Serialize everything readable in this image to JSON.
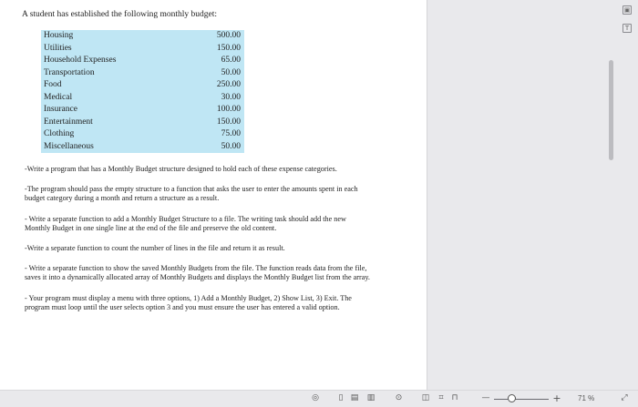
{
  "document": {
    "intro": "A student has established the following monthly budget:",
    "budget": [
      {
        "category": "Housing",
        "amount": "500.00"
      },
      {
        "category": "Utilities",
        "amount": "150.00"
      },
      {
        "category": "Household Expenses",
        "amount": "65.00"
      },
      {
        "category": "Transportation",
        "amount": "50.00"
      },
      {
        "category": "Food",
        "amount": "250.00"
      },
      {
        "category": "Medical",
        "amount": "30.00"
      },
      {
        "category": "Insurance",
        "amount": "100.00"
      },
      {
        "category": "Entertainment",
        "amount": "150.00"
      },
      {
        "category": "Clothing",
        "amount": "75.00"
      },
      {
        "category": "Miscellaneous",
        "amount": "50.00"
      }
    ],
    "paragraphs": [
      "-Write a program that has a Monthly Budget structure designed to hold each of these expense categories.",
      "-The program should pass the empty structure to a function that asks the user to enter the amounts spent in each budget category during a month and return a structure as a result.",
      "- Write a separate function to add a Monthly Budget Structure to a file. The writing task should add the new Monthly Budget in one single line at the end of the file and preserve the old content.",
      "-Write a separate function to count the number of lines in the file and return it as result.",
      "- Write a separate function to show the saved Monthly Budgets from the file. The function reads data from the file, saves it into a dynamically allocated array of Monthly Budgets and displays the Monthly Budget list from the array.",
      "- Your program must display a menu with three options, 1) Add a Monthly Budget, 2) Show List, 3) Exit. The program must loop until the user selects option 3 and you must ensure the user has entered a valid option."
    ]
  },
  "sidebar_icons": [
    "image-icon",
    "text-recognition-icon"
  ],
  "status_bar": {
    "icons": [
      "eye-icon",
      "single-page-icon",
      "double-page-icon",
      "book-view-icon",
      "play-icon",
      "dual-view-icon",
      "translate-icon",
      "bookmark-icon"
    ],
    "zoom_minus": "—",
    "zoom_plus": "+",
    "zoom_level": "71 %",
    "zoom_fraction": 0.32,
    "fit_icon": "expand-icon"
  }
}
